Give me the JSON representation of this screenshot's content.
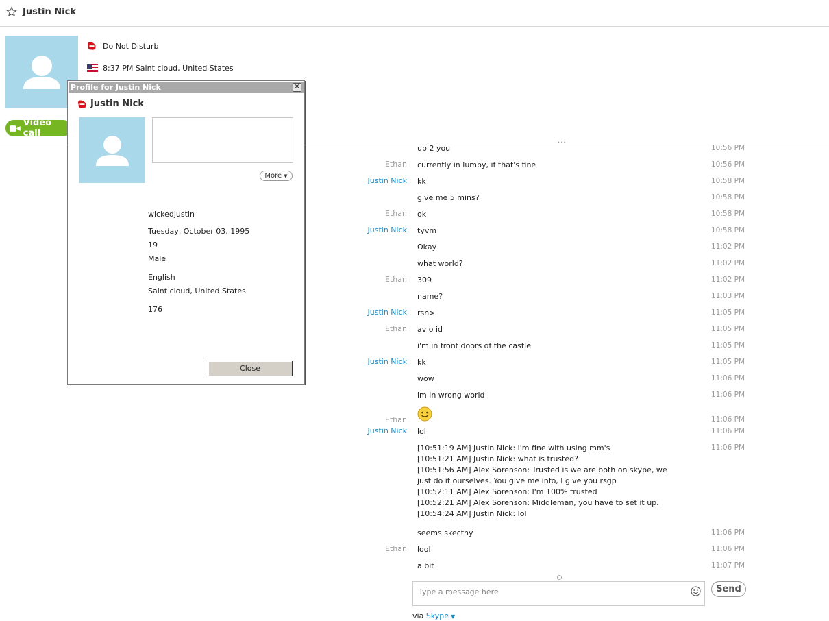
{
  "header": {
    "title": "Justin Nick"
  },
  "contact": {
    "status": "Do Not Disturb",
    "local_time_location": "8:37 PM Saint cloud, United States",
    "video_call_label": "Video call"
  },
  "profile_dialog": {
    "window_title": "Profile for Justin Nick",
    "name": "Justin Nick",
    "more_label": "More",
    "skype_name": "wickedjustin",
    "birthday": "Tuesday, October 03, 1995",
    "age": "19",
    "gender": "Male",
    "language": "English",
    "location": "Saint cloud, United States",
    "phone": "176",
    "close_label": "Close"
  },
  "chat": {
    "messages": [
      {
        "sender": "",
        "sender_class": "ethan",
        "text": "up 2 you",
        "time": "10:56 PM"
      },
      {
        "sender": "Ethan",
        "sender_class": "ethan",
        "text": "currently in lumby, if that's fine",
        "time": "10:56 PM"
      },
      {
        "sender": "Justin Nick",
        "sender_class": "justin",
        "text": "kk",
        "time": "10:58 PM"
      },
      {
        "sender": "",
        "sender_class": "justin",
        "text": "give me 5 mins?",
        "time": "10:58 PM"
      },
      {
        "sender": "Ethan",
        "sender_class": "ethan",
        "text": "ok",
        "time": "10:58 PM"
      },
      {
        "sender": "Justin Nick",
        "sender_class": "justin",
        "text": "tyvm",
        "time": "10:58 PM"
      },
      {
        "sender": "",
        "sender_class": "justin",
        "text": "Okay",
        "time": "11:02 PM"
      },
      {
        "sender": "",
        "sender_class": "justin",
        "text": "what world?",
        "time": "11:02 PM"
      },
      {
        "sender": "Ethan",
        "sender_class": "ethan",
        "text": "309",
        "time": "11:02 PM"
      },
      {
        "sender": "",
        "sender_class": "ethan",
        "text": "name?",
        "time": "11:03 PM"
      },
      {
        "sender": "Justin Nick",
        "sender_class": "justin",
        "text": "rsn>",
        "time": "11:05 PM"
      },
      {
        "sender": "Ethan",
        "sender_class": "ethan",
        "text": "av o id",
        "time": "11:05 PM"
      },
      {
        "sender": "",
        "sender_class": "ethan",
        "text": "i'm in front doors of the castle",
        "time": "11:05 PM"
      },
      {
        "sender": "Justin Nick",
        "sender_class": "justin",
        "text": "kk",
        "time": "11:05 PM"
      },
      {
        "sender": "",
        "sender_class": "justin",
        "text": "wow",
        "time": "11:06 PM"
      },
      {
        "sender": "",
        "sender_class": "justin",
        "text": "im in wrong world",
        "time": "11:06 PM"
      },
      {
        "sender": "Ethan",
        "sender_class": "ethan",
        "text": "",
        "emoticon": "smile",
        "time": "11:06 PM"
      },
      {
        "sender": "Justin Nick",
        "sender_class": "justin",
        "text": "lol",
        "time": "11:06 PM"
      },
      {
        "sender": "",
        "sender_class": "justin",
        "lines": [
          "[10:51:19 AM] Justin Nick: i'm fine with using mm's",
          "[10:51:21 AM] Justin Nick: what is trusted?",
          "[10:51:56 AM] Alex Sorenson: Trusted is we are both on skype, we just do it ourselves. You give me info, I give you rsgp",
          "[10:52:11 AM] Alex Sorenson: I'm 100% trusted",
          "[10:52:21 AM] Alex Sorenson: Middleman, you have to set it up.",
          "[10:54:24 AM] Justin Nick: lol"
        ],
        "time": "11:06 PM"
      },
      {
        "sender": "",
        "sender_class": "justin",
        "text": "seems skecthy",
        "time": "11:06 PM"
      },
      {
        "sender": "Ethan",
        "sender_class": "ethan",
        "text": "lool",
        "time": "11:06 PM"
      },
      {
        "sender": "",
        "sender_class": "ethan",
        "text": "a bit",
        "time": "11:07 PM"
      }
    ]
  },
  "compose": {
    "placeholder": "Type a message here",
    "send_label": "Send",
    "via_label": "via",
    "via_service": "Skype"
  },
  "colors": {
    "accent": "#1a8ec8",
    "video_call_green": "#77b623",
    "avatar_bg": "#a8d8ea",
    "dnd_red": "#d7121f"
  },
  "icons": {
    "favorite": "star-icon",
    "status": "do-not-disturb-icon",
    "country": "us-flag-icon",
    "video": "video-camera-icon",
    "emoticons": "emoticon-icon"
  }
}
